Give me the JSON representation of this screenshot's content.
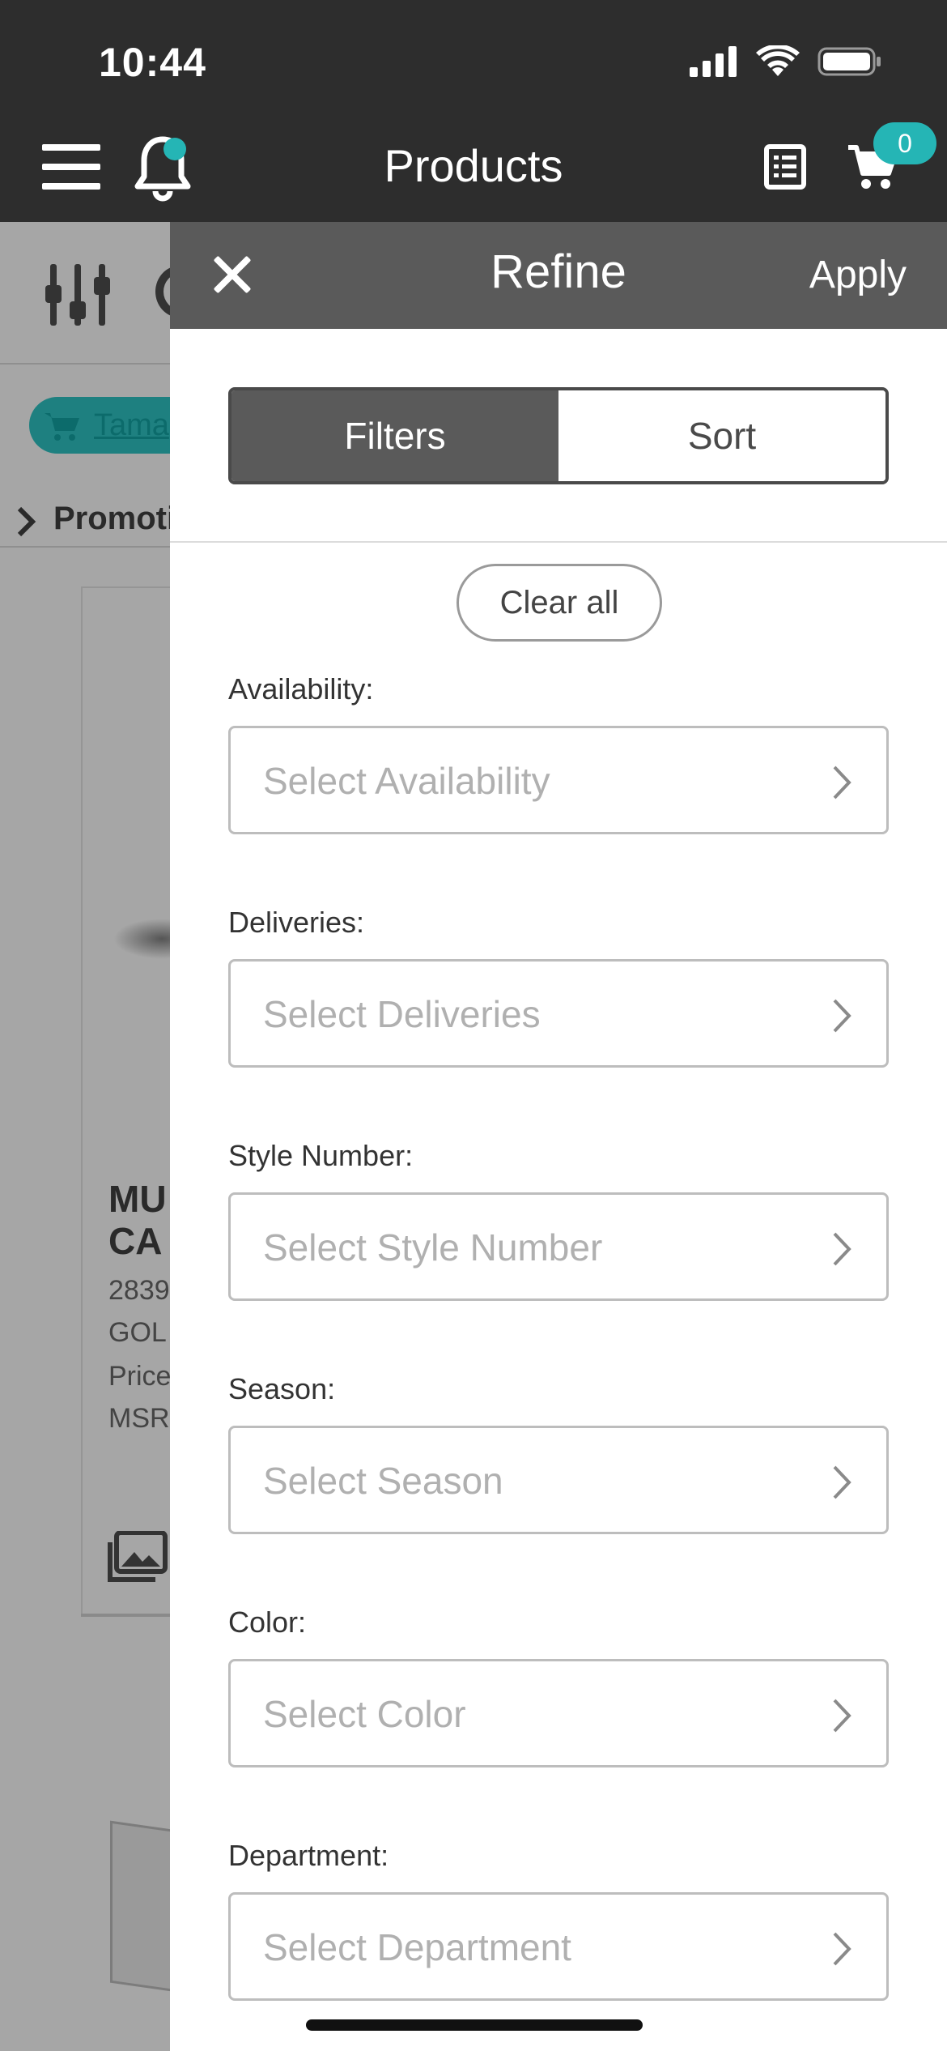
{
  "status_bar": {
    "time": "10:44"
  },
  "header": {
    "title": "Products",
    "cart_count": "0"
  },
  "background": {
    "chip_text": "Tama",
    "promo_text": "Promoti",
    "product_name_line1": "MU",
    "product_name_line2": "CA",
    "sku": "2839",
    "color": "GOL",
    "price_label": "Price",
    "msrp_label": "MSR"
  },
  "refine": {
    "title": "Refine",
    "apply_label": "Apply",
    "tabs": [
      {
        "label": "Filters",
        "active": true
      },
      {
        "label": "Sort",
        "active": false
      }
    ],
    "clear_all_label": "Clear all",
    "fields": [
      {
        "label": "Availability:",
        "placeholder": "Select Availability"
      },
      {
        "label": "Deliveries:",
        "placeholder": "Select Deliveries"
      },
      {
        "label": "Style Number:",
        "placeholder": "Select Style Number"
      },
      {
        "label": "Season:",
        "placeholder": "Select Season"
      },
      {
        "label": "Color:",
        "placeholder": "Select Color"
      },
      {
        "label": "Department:",
        "placeholder": "Select Department"
      }
    ]
  },
  "colors": {
    "header_bg": "#2d2d2d",
    "panel_header_bg": "#5a5a5a",
    "accent": "#25b5b5"
  }
}
